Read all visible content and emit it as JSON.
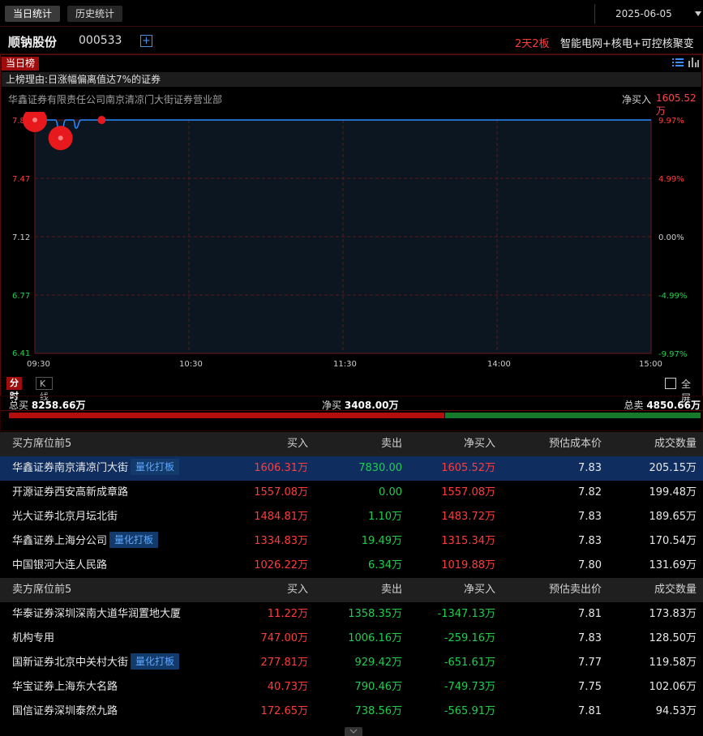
{
  "tabs": [
    {
      "label": "当日统计",
      "active": true
    },
    {
      "label": "历史统计",
      "active": false
    }
  ],
  "date": "2025-06-05",
  "stock": {
    "name": "顺钠股份",
    "code": "000533",
    "consecutive": "2天2板",
    "concept": "智能电网+核电+可控核聚变"
  },
  "panel": {
    "tag": "当日榜",
    "reason": "上榜理由:日涨幅偏离值达7%的证券",
    "seat": "华鑫证券有限责任公司南京清凉门大街证券营业部",
    "net_label": "净买入",
    "net_value": "1605.52万"
  },
  "chart_data": {
    "type": "line",
    "y_left_ticks": [
      "7.83",
      "7.47",
      "7.12",
      "6.77",
      "6.41"
    ],
    "y_right_ticks": [
      "9.97%",
      "4.99%",
      "0.00%",
      "-4.99%",
      "-9.97%"
    ],
    "x_ticks": [
      "09:30",
      "10:30",
      "11:30",
      "14:00",
      "15:00"
    ],
    "ylim": [
      6.41,
      7.83
    ],
    "price_series": [
      {
        "t": "09:30",
        "price": 7.83
      },
      {
        "t": "09:38",
        "price": 7.83
      },
      {
        "t": "09:40",
        "price": 7.72
      },
      {
        "t": "09:42",
        "price": 7.83
      },
      {
        "t": "09:45",
        "price": 7.83
      },
      {
        "t": "09:46",
        "price": 7.78
      },
      {
        "t": "09:48",
        "price": 7.83
      },
      {
        "t": "15:00",
        "price": 7.83
      }
    ],
    "markers": [
      {
        "t": "09:30",
        "price": 7.83,
        "kind": "large"
      },
      {
        "t": "09:40",
        "price": 7.72,
        "kind": "large"
      },
      {
        "t": "09:56",
        "price": 7.83,
        "kind": "small"
      }
    ],
    "colors": {
      "line": "#2a8cff",
      "up": "#ff3c3c",
      "down": "#1fce4f",
      "marker": "#e8191c"
    }
  },
  "chart_tabs": [
    {
      "label": "分时",
      "active": true
    },
    {
      "label": "K线",
      "active": false
    }
  ],
  "fullscreen_label": "全屏",
  "totals": {
    "buy_label": "总买",
    "buy_value": "8258.66万",
    "net_label": "净买",
    "net_value": "3408.00万",
    "sell_label": "总卖",
    "sell_value": "4850.66万",
    "buy_ratio": 0.63
  },
  "buy_table": {
    "headers": [
      "买方席位前5",
      "买入",
      "卖出",
      "净买入",
      "预估成本价",
      "成交数量"
    ],
    "rows": [
      {
        "name": "华鑫证券南京清凉门大街",
        "tag": "量化打板",
        "buy": "1606.31万",
        "sell": "7830.00",
        "net": "1605.52万",
        "price": "7.83",
        "vol": "205.15万",
        "selected": true
      },
      {
        "name": "开源证券西安高新成章路",
        "tag": "",
        "buy": "1557.08万",
        "sell": "0.00",
        "net": "1557.08万",
        "price": "7.82",
        "vol": "199.48万",
        "selected": false
      },
      {
        "name": "光大证券北京月坛北街",
        "tag": "",
        "buy": "1484.81万",
        "sell": "1.10万",
        "net": "1483.72万",
        "price": "7.83",
        "vol": "189.65万",
        "selected": false
      },
      {
        "name": "华鑫证券上海分公司",
        "tag": "量化打板",
        "buy": "1334.83万",
        "sell": "19.49万",
        "net": "1315.34万",
        "price": "7.83",
        "vol": "170.54万",
        "selected": false
      },
      {
        "name": "中国银河大连人民路",
        "tag": "",
        "buy": "1026.22万",
        "sell": "6.34万",
        "net": "1019.88万",
        "price": "7.80",
        "vol": "131.69万",
        "selected": false
      }
    ]
  },
  "sell_table": {
    "headers": [
      "卖方席位前5",
      "买入",
      "卖出",
      "净买入",
      "预估卖出价",
      "成交数量"
    ],
    "rows": [
      {
        "name": "华泰证券深圳深南大道华润置地大厦",
        "tag": "",
        "buy": "11.22万",
        "sell": "1358.35万",
        "net": "-1347.13万",
        "price": "7.81",
        "vol": "173.83万"
      },
      {
        "name": "机构专用",
        "tag": "",
        "buy": "747.00万",
        "sell": "1006.16万",
        "net": "-259.16万",
        "price": "7.83",
        "vol": "128.50万"
      },
      {
        "name": "国新证券北京中关村大街",
        "tag": "量化打板",
        "buy": "277.81万",
        "sell": "929.42万",
        "net": "-651.61万",
        "price": "7.77",
        "vol": "119.58万"
      },
      {
        "name": "华宝证券上海东大名路",
        "tag": "",
        "buy": "40.73万",
        "sell": "790.46万",
        "net": "-749.73万",
        "price": "7.75",
        "vol": "102.06万"
      },
      {
        "name": "国信证券深圳泰然九路",
        "tag": "",
        "buy": "172.65万",
        "sell": "738.56万",
        "net": "-565.91万",
        "price": "7.81",
        "vol": "94.53万"
      }
    ]
  }
}
